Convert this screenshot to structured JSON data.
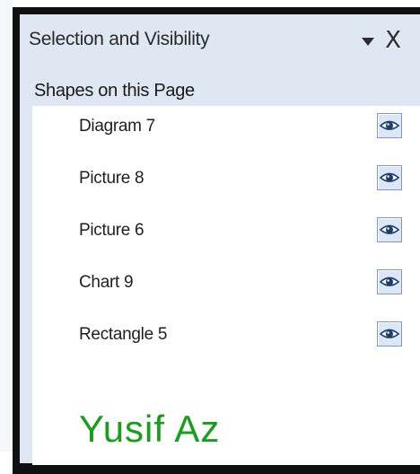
{
  "pane": {
    "title": "Selection and Visibility",
    "close_glyph": "X",
    "dropdown_icon": "chevron-down-icon"
  },
  "section": {
    "label": "Shapes on this Page"
  },
  "shapes": [
    {
      "label": "Diagram 7",
      "visible": true
    },
    {
      "label": "Picture 8",
      "visible": true
    },
    {
      "label": "Picture 6",
      "visible": true
    },
    {
      "label": "Chart 9",
      "visible": true
    },
    {
      "label": "Rectangle 5",
      "visible": true
    }
  ],
  "watermark": "Yusif Az",
  "colors": {
    "pane_background": "#dfe7f2",
    "frame": "#101010",
    "list_background": "#ffffff",
    "eye_button_border": "#7f9ab8",
    "watermark": "#16a01a"
  }
}
